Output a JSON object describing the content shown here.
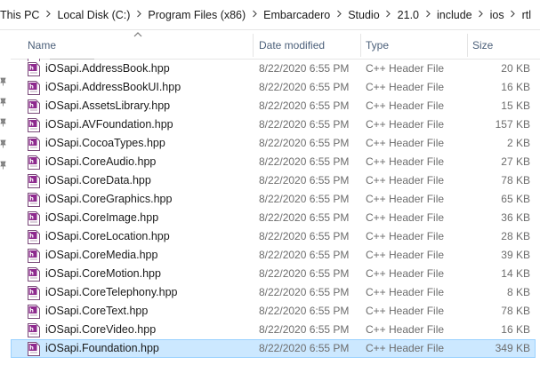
{
  "breadcrumb": [
    "This PC",
    "Local Disk (C:)",
    "Program Files (x86)",
    "Embarcadero",
    "Studio",
    "21.0",
    "include",
    "ios",
    "rtl"
  ],
  "columns": {
    "name": "Name",
    "date_modified": "Date modified",
    "type": "Type",
    "size": "Size"
  },
  "files": [
    {
      "name": "iOSapi.AddressBook.hpp",
      "date": "8/22/2020 6:55 PM",
      "type": "C++ Header File",
      "size": "20 KB"
    },
    {
      "name": "iOSapi.AddressBookUI.hpp",
      "date": "8/22/2020 6:55 PM",
      "type": "C++ Header File",
      "size": "16 KB"
    },
    {
      "name": "iOSapi.AssetsLibrary.hpp",
      "date": "8/22/2020 6:55 PM",
      "type": "C++ Header File",
      "size": "15 KB"
    },
    {
      "name": "iOSapi.AVFoundation.hpp",
      "date": "8/22/2020 6:55 PM",
      "type": "C++ Header File",
      "size": "157 KB"
    },
    {
      "name": "iOSapi.CocoaTypes.hpp",
      "date": "8/22/2020 6:55 PM",
      "type": "C++ Header File",
      "size": "2 KB"
    },
    {
      "name": "iOSapi.CoreAudio.hpp",
      "date": "8/22/2020 6:55 PM",
      "type": "C++ Header File",
      "size": "27 KB"
    },
    {
      "name": "iOSapi.CoreData.hpp",
      "date": "8/22/2020 6:55 PM",
      "type": "C++ Header File",
      "size": "78 KB"
    },
    {
      "name": "iOSapi.CoreGraphics.hpp",
      "date": "8/22/2020 6:55 PM",
      "type": "C++ Header File",
      "size": "65 KB"
    },
    {
      "name": "iOSapi.CoreImage.hpp",
      "date": "8/22/2020 6:55 PM",
      "type": "C++ Header File",
      "size": "36 KB"
    },
    {
      "name": "iOSapi.CoreLocation.hpp",
      "date": "8/22/2020 6:55 PM",
      "type": "C++ Header File",
      "size": "28 KB"
    },
    {
      "name": "iOSapi.CoreMedia.hpp",
      "date": "8/22/2020 6:55 PM",
      "type": "C++ Header File",
      "size": "39 KB"
    },
    {
      "name": "iOSapi.CoreMotion.hpp",
      "date": "8/22/2020 6:55 PM",
      "type": "C++ Header File",
      "size": "14 KB"
    },
    {
      "name": "iOSapi.CoreTelephony.hpp",
      "date": "8/22/2020 6:55 PM",
      "type": "C++ Header File",
      "size": "8 KB"
    },
    {
      "name": "iOSapi.CoreText.hpp",
      "date": "8/22/2020 6:55 PM",
      "type": "C++ Header File",
      "size": "78 KB"
    },
    {
      "name": "iOSapi.CoreVideo.hpp",
      "date": "8/22/2020 6:55 PM",
      "type": "C++ Header File",
      "size": "16 KB"
    },
    {
      "name": "iOSapi.Foundation.hpp",
      "date": "8/22/2020 6:55 PM",
      "type": "C++ Header File",
      "size": "349 KB"
    }
  ],
  "selected_index": 15,
  "icons": {
    "file": "cpp-header-file-icon",
    "separator": "chevron-right-icon",
    "sort": "sort-up-caret-icon",
    "pin": "pin-icon"
  },
  "colors": {
    "selection": "#cce8ff",
    "selection_border": "#99d1ff",
    "header_text": "#4c607a",
    "secondary_text": "#6d6d6d"
  }
}
